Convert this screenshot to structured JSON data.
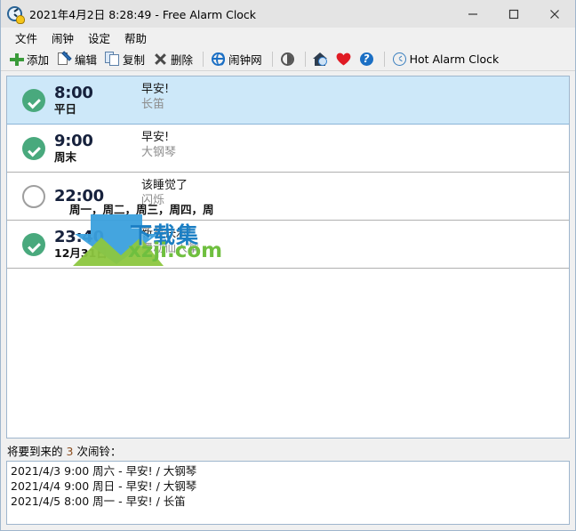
{
  "window": {
    "title": "2021年4月2日 8:28:49 - Free Alarm Clock",
    "icon": "alarm-clock-icon",
    "minimize_label": "minimize-icon",
    "maximize_label": "maximize-icon",
    "close_label": "close-icon"
  },
  "menu": {
    "items": [
      {
        "label": "文件"
      },
      {
        "label": "闹钟"
      },
      {
        "label": "设定"
      },
      {
        "label": "帮助"
      }
    ]
  },
  "toolbar": {
    "buttons": [
      {
        "label": "添加",
        "icon": "plus-icon"
      },
      {
        "label": "编辑",
        "icon": "edit-pencil-icon"
      },
      {
        "label": "复制",
        "icon": "copy-icon"
      },
      {
        "label": "删除",
        "icon": "delete-x-icon"
      },
      {
        "label": "闹钟网",
        "icon": "globe-icon"
      },
      {
        "label": "",
        "icon": "contrast-icon"
      },
      {
        "label": "",
        "icon": "house-globe-icon"
      },
      {
        "label": "",
        "icon": "heart-icon"
      },
      {
        "label": "",
        "icon": "help-question-icon"
      },
      {
        "label": "Hot Alarm Clock",
        "icon": "hot-alarm-clock-icon"
      }
    ]
  },
  "alarms": [
    {
      "enabled": true,
      "state": "on",
      "time": "8:00",
      "days": "平日",
      "label": "早安!",
      "sound": "长笛",
      "selected": true
    },
    {
      "enabled": true,
      "state": "on",
      "time": "9:00",
      "days": "周末",
      "label": "早安!",
      "sound": "大钢琴",
      "selected": false
    },
    {
      "enabled": false,
      "state": "off",
      "time": "22:00",
      "days": "周一，周二，周三，周四，周",
      "label": "该睡觉了",
      "sound": "闪烁",
      "selected": false
    },
    {
      "enabled": true,
      "state": "on",
      "time": "23:40",
      "days": "12月31日",
      "label": "新年快乐!",
      "sound": "舞动仙人掌",
      "selected": false
    }
  ],
  "watermark": {
    "line1": "下载集",
    "line2": "xzji.com"
  },
  "status": {
    "prefix": "将要到来的",
    "count": "3",
    "suffix": "次闹铃：",
    "upcoming": [
      "2021/4/3 9:00 周六 - 早安! / 大钢琴",
      "2021/4/4 9:00 周日 - 早安! / 大钢琴",
      "2021/4/5 8:00 周一 - 早安! / 长笛"
    ]
  },
  "colors": {
    "accent_blue": "#1b6fc4",
    "enabled_green": "#49a97d",
    "selected_row": "#cde8f9",
    "count_orange": "#8a4b1c",
    "heart_red": "#e01b24",
    "watermark_blue": "#1b7fc4",
    "watermark_green": "#6fbf3f"
  }
}
